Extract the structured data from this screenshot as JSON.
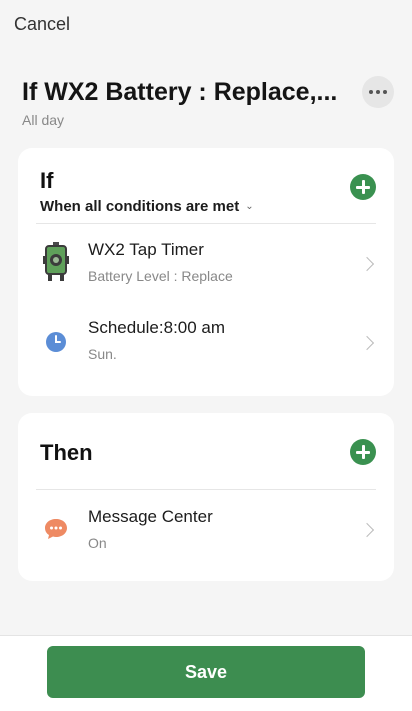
{
  "header": {
    "cancel_label": "Cancel",
    "title": "If WX2 Battery : Replace,...",
    "subtitle": "All day",
    "more_icon": "more-horizontal-icon"
  },
  "if_section": {
    "title": "If",
    "condition_mode": "When all conditions are met",
    "add_icon": "plus-icon",
    "items": [
      {
        "icon": "tap-timer-device-icon",
        "label": "WX2 Tap Timer",
        "detail": "Battery Level : Replace"
      },
      {
        "icon": "clock-icon",
        "label": "Schedule:8:00 am",
        "detail": "Sun."
      }
    ]
  },
  "then_section": {
    "title": "Then",
    "add_icon": "plus-icon",
    "items": [
      {
        "icon": "message-bubble-icon",
        "label": "Message Center",
        "detail": "On"
      }
    ]
  },
  "footer": {
    "save_label": "Save"
  },
  "colors": {
    "accent_green": "#3a9150",
    "clock_blue": "#5b8dd6",
    "message_orange": "#ee8a63",
    "background": "#f5f5f5"
  }
}
